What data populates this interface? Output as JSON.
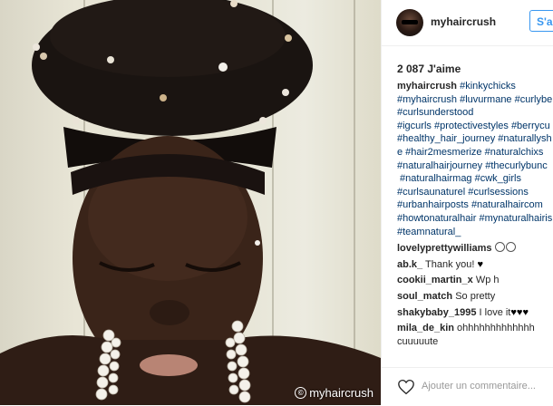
{
  "post": {
    "username": "myhaircrush",
    "follow_label": "S'abonner",
    "likes": "2 087 J'aime",
    "caption_lines": [
      "#kinkychicks",
      "#myhaircrush #luvurmane #curlybe",
      "#curlsunderstood",
      "#igcurls #protectivestyles #berrycu",
      "#healthy_hair_journey #naturallysh",
      "e #hair2mesmerize #naturalchixs",
      "#naturalhairjourney #thecurlybunc",
      " #naturalhairmag #cwk_girls",
      "#curlsaunaturel #curlsessions",
      "#urbanhairposts #naturalhaircom",
      "#howtonaturalhair #mynaturalhairis",
      "#teamnatural_"
    ],
    "comments": [
      {
        "user": "lovelyprettywilliams",
        "text": "",
        "emoji_count": 2
      },
      {
        "user": "ab.k_",
        "text": "Thank you! ",
        "hearts": "♥"
      },
      {
        "user": "cookii_martin_x",
        "text": "Wp h"
      },
      {
        "user": "soul_match",
        "text": "So pretty"
      },
      {
        "user": "shakybaby_1995",
        "text": "I love it",
        "hearts": "♥♥♥"
      },
      {
        "user": "mila_de_kin",
        "text": "ohhhhhhhhhhhhh",
        "text2": "cuuuuute"
      }
    ],
    "add_comment_placeholder": "Ajouter un commentaire...",
    "watermark": "myhaircrush"
  },
  "icons": {
    "avatar": "avatar",
    "like": "heart-outline-icon"
  },
  "colors": {
    "link": "#003569",
    "follow": "#3897f0",
    "text": "#262626"
  }
}
